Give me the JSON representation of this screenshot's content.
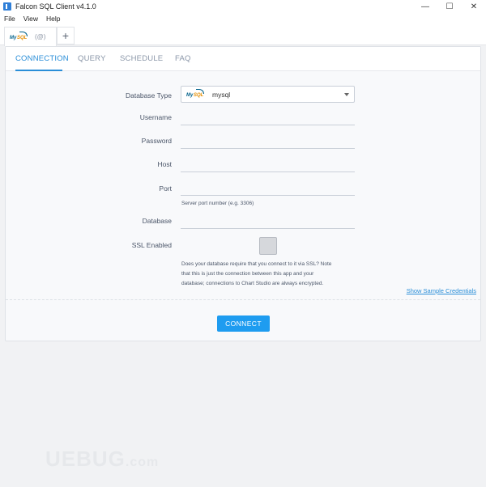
{
  "window": {
    "title": "Falcon SQL Client v4.1.0",
    "controls": {
      "minimize": "—",
      "maximize": "☐",
      "close": "✕"
    }
  },
  "menu": [
    "File",
    "View",
    "Help"
  ],
  "tabs": {
    "connection_label": "(@)",
    "add_label": "+"
  },
  "nav": {
    "items": [
      "CONNECTION",
      "QUERY",
      "SCHEDULE",
      "FAQ"
    ],
    "active": "CONNECTION"
  },
  "form": {
    "database_type": {
      "label": "Database Type",
      "value": "mysql",
      "logo_my": "My",
      "logo_sql": "SQL"
    },
    "username": {
      "label": "Username",
      "value": ""
    },
    "password": {
      "label": "Password",
      "value": ""
    },
    "host": {
      "label": "Host",
      "value": ""
    },
    "port": {
      "label": "Port",
      "value": "",
      "hint": "Server port number (e.g. 3306)"
    },
    "database": {
      "label": "Database",
      "value": ""
    },
    "ssl": {
      "label": "SSL Enabled",
      "checked": false,
      "hint_lines": [
        "Does your database require that you connect to it via SSL? Note",
        "that this is just the connection between this app and your",
        "database; connections to Chart Studio are always encrypted."
      ]
    }
  },
  "sample_link": "Show Sample Credentials",
  "connect_button": "CONNECT",
  "watermark": {
    "main": "UEBUG",
    "suffix": ".com"
  }
}
